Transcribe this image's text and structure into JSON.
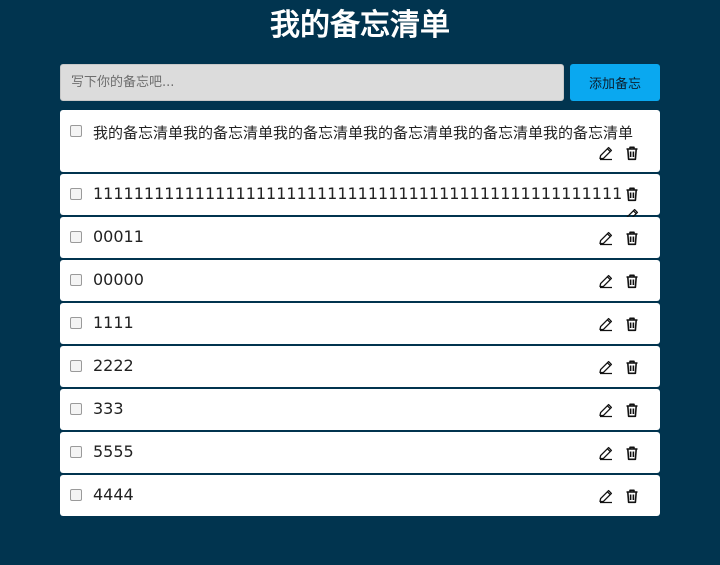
{
  "page": {
    "title": "我的备忘清单"
  },
  "input": {
    "placeholder": "写下你的备忘吧...",
    "value": ""
  },
  "add_button": {
    "label": "添加备忘"
  },
  "memos": [
    {
      "text": "我的备忘清单我的备忘清单我的备忘清单我的备忘清单我的备忘清单我的备忘清单",
      "checked": false
    },
    {
      "text": "11111111111111111111111111111111111111111111111111111111111111",
      "checked": false
    },
    {
      "text": "00011",
      "checked": false
    },
    {
      "text": "00000",
      "checked": false
    },
    {
      "text": "1111",
      "checked": false
    },
    {
      "text": "2222",
      "checked": false
    },
    {
      "text": "333",
      "checked": false
    },
    {
      "text": "5555",
      "checked": false
    },
    {
      "text": "4444",
      "checked": false
    }
  ],
  "icons": {
    "edit": "pencil-icon",
    "delete": "trash-icon"
  },
  "colors": {
    "background": "#01344f",
    "accent": "#0aa8f0",
    "card": "#ffffff"
  }
}
